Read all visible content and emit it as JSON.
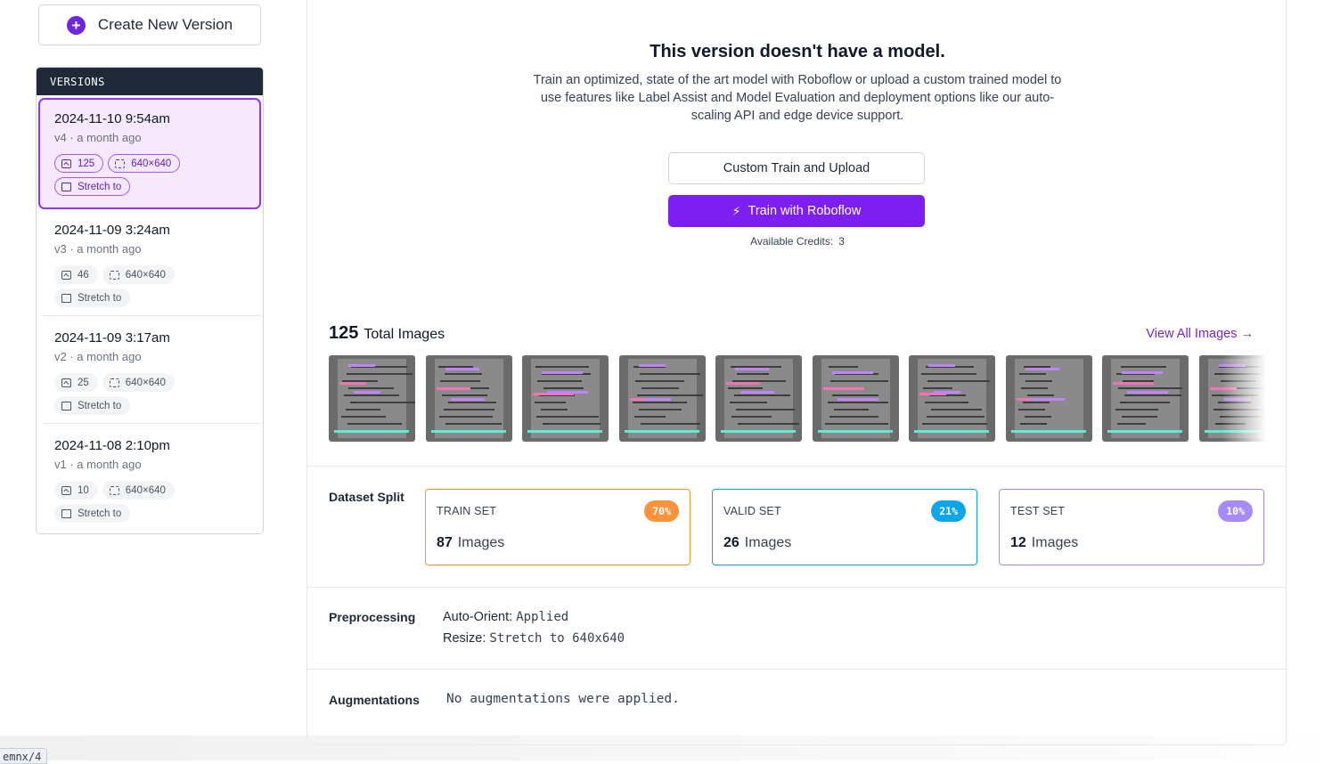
{
  "sidebar": {
    "create_button": "Create New Version",
    "versions_header": "VERSIONS",
    "versions": [
      {
        "date": "2024-11-10 9:54am",
        "version": "v4",
        "age": "a month ago",
        "images": "125",
        "size": "640×640",
        "transform": "Stretch to",
        "selected": true
      },
      {
        "date": "2024-11-09 3:24am",
        "version": "v3",
        "age": "a month ago",
        "images": "46",
        "size": "640×640",
        "transform": "Stretch to"
      },
      {
        "date": "2024-11-09 3:17am",
        "version": "v2",
        "age": "a month ago",
        "images": "25",
        "size": "640×640",
        "transform": "Stretch to"
      },
      {
        "date": "2024-11-08 2:10pm",
        "version": "v1",
        "age": "a month ago",
        "images": "10",
        "size": "640×640",
        "transform": "Stretch to"
      }
    ]
  },
  "model": {
    "title": "This version doesn't have a model.",
    "description": "Train an optimized, state of the art model with Roboflow or upload a custom trained model to use features like Label Assist and Model Evaluation and deployment options like our auto-scaling API and edge device support.",
    "custom_button": "Custom Train and Upload",
    "train_button": "Train with Roboflow",
    "credits_label": "Available Credits:",
    "credits_value": "3"
  },
  "images": {
    "count": "125",
    "label": "Total Images",
    "view_all": "View All Images →",
    "thumbnail_count": 10
  },
  "split": {
    "label": "Dataset Split",
    "cards": [
      {
        "name": "TRAIN SET",
        "percent": "70%",
        "count": "87",
        "unit": "Images",
        "color": "#fb923c"
      },
      {
        "name": "VALID SET",
        "percent": "21%",
        "count": "26",
        "unit": "Images",
        "color": "#0ea5e9"
      },
      {
        "name": "TEST SET",
        "percent": "10%",
        "count": "12",
        "unit": "Images",
        "color": "#a78bfa"
      }
    ]
  },
  "preprocessing": {
    "label": "Preprocessing",
    "items": [
      {
        "key": "Auto-Orient:",
        "value": "Applied"
      },
      {
        "key": "Resize:",
        "value": "Stretch to 640x640"
      }
    ]
  },
  "augmentations": {
    "label": "Augmentations",
    "value": "No augmentations were applied."
  },
  "status_url": "emnx/4",
  "colors": {
    "accent": "#7c1ff0",
    "selected_bg": "#f5e9fb",
    "header_dark": "#1f2937"
  }
}
